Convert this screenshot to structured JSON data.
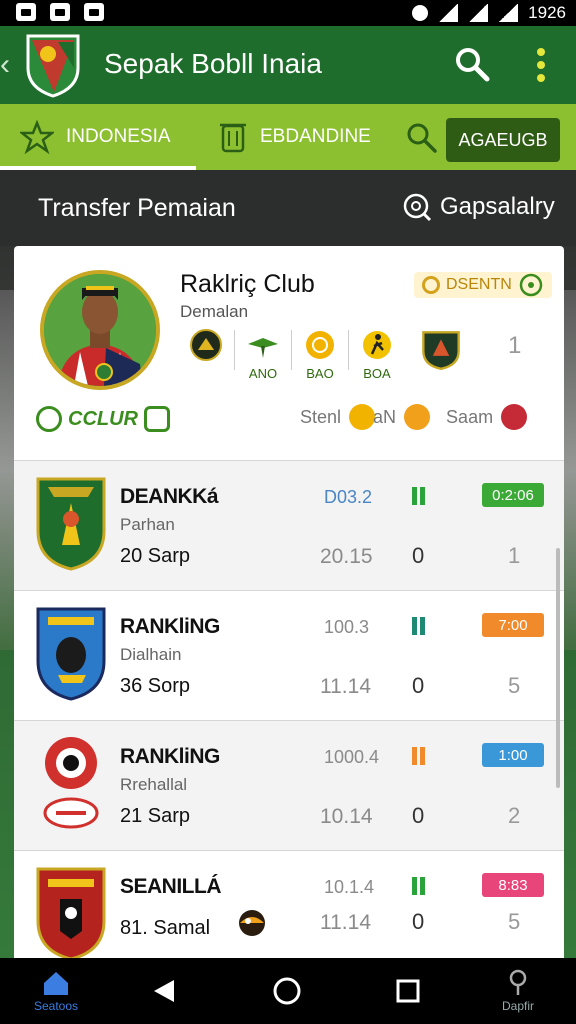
{
  "status_bar": {
    "time": "1926"
  },
  "app_bar": {
    "title": "Sepak Bobll Inaia"
  },
  "tabs": {
    "items": [
      {
        "label": "INDONESIA"
      },
      {
        "label": "EBDANDINE"
      }
    ],
    "action_label": "AGAEUGB"
  },
  "section": {
    "title": "Transfer Pemaian",
    "gallery_label": "Gapsalalry"
  },
  "profile": {
    "name": "Raklriç Club",
    "subtitle": "Demalan",
    "badge": "DSENTN",
    "count": "1",
    "stats": [
      {
        "label": ""
      },
      {
        "label": "ANO"
      },
      {
        "label": "BAO"
      },
      {
        "label": "BOA"
      }
    ],
    "club_label": "CCLUR",
    "stat_label_1": "Stenl",
    "stat_label_2": "aN",
    "stat_label_3": "Saam"
  },
  "rows": [
    {
      "title": "DEANKKá",
      "subtitle": "Parhan",
      "date": "20  Sarp",
      "num1": "D03.2",
      "num2": "20.15",
      "zero": "0",
      "badge": "0:2:06",
      "badge_color": "#3aa935",
      "bar_color": "#2aa43a",
      "count": "1"
    },
    {
      "title": "RANKliNG",
      "subtitle": "Dialhain",
      "date": "36  Sorp",
      "num1": "100.3",
      "num2": "11.14",
      "zero": "0",
      "badge": "7:00",
      "badge_color": "#f08a2b",
      "bar_color": "#1e8a73",
      "count": "5"
    },
    {
      "title": "RANKliNG",
      "subtitle": "Rrehallal",
      "date": "21  Sarp",
      "num1": "1000.4",
      "num2": "10.14",
      "zero": "0",
      "badge": "1:00",
      "badge_color": "#3a98d8",
      "bar_color": "#f08a2b",
      "count": "2"
    },
    {
      "title": "SEANILLÁ",
      "subtitle": "",
      "date": "81. Samal",
      "num1": "10.1.4",
      "num2": "11.14",
      "zero": "0",
      "badge": "8:83",
      "badge_color": "#e8457a",
      "bar_color": "#2aa43a",
      "count": "5"
    }
  ],
  "nav": {
    "home_label": "Seatoos",
    "profile_label": "Dapfir"
  }
}
